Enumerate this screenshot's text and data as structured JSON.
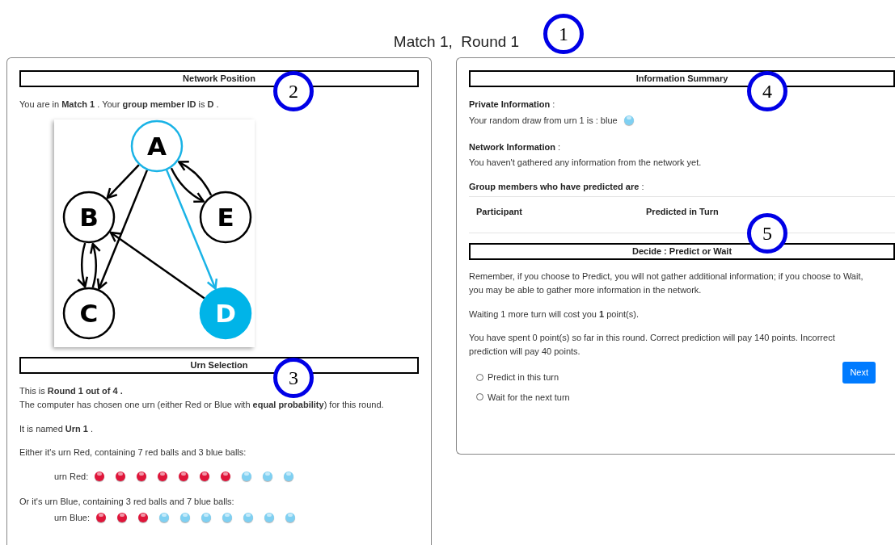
{
  "title": "Match 1,  Round 1",
  "callouts": [
    "1",
    "2",
    "3",
    "4",
    "5"
  ],
  "network": {
    "header": "Network Position",
    "intro": "You are in **Match 1** . Your **group member ID** is **D** .",
    "nodes": [
      {
        "label": "A",
        "kind": "outline"
      },
      {
        "label": "B",
        "kind": "plain"
      },
      {
        "label": "E",
        "kind": "plain"
      },
      {
        "label": "C",
        "kind": "plain"
      },
      {
        "label": "D",
        "kind": "filled"
      }
    ]
  },
  "urn_selection": {
    "header": "Urn Selection",
    "lines": [
      "This is **Round 1 out of 4 .**",
      "The computer has chosen one urn (either Red or Blue with **equal probability**) for this round.",
      "It is named **Urn 1** ."
    ],
    "urns": [
      {
        "intro": "Either it's urn Red, containing 7 red balls and 3 blue balls:",
        "label": "urn Red:",
        "balls": [
          {
            "color": "#e0153a"
          },
          {
            "color": "#e0153a"
          },
          {
            "color": "#e0153a"
          },
          {
            "color": "#e0153a"
          },
          {
            "color": "#e0153a"
          },
          {
            "color": "#e0153a"
          },
          {
            "color": "#e0153a"
          },
          {
            "color": "#7fd0f2"
          },
          {
            "color": "#7fd0f2"
          },
          {
            "color": "#7fd0f2"
          }
        ]
      },
      {
        "intro": "Or it's urn Blue, containing 3 red balls and 7 blue balls:",
        "label": "urn Blue:",
        "balls": [
          {
            "color": "#e0153a"
          },
          {
            "color": "#e0153a"
          },
          {
            "color": "#e0153a"
          },
          {
            "color": "#7fd0f2"
          },
          {
            "color": "#7fd0f2"
          },
          {
            "color": "#7fd0f2"
          },
          {
            "color": "#7fd0f2"
          },
          {
            "color": "#7fd0f2"
          },
          {
            "color": "#7fd0f2"
          },
          {
            "color": "#7fd0f2"
          }
        ]
      }
    ]
  },
  "summary": {
    "header": "Information Summary",
    "private_title": "Private Information",
    "private_sep": ":",
    "private_text": "Your random draw from urn 1 is : blue",
    "private_ball": {
      "color": "#7fd0f2"
    },
    "network_title": "Network Information",
    "network_sep": ":",
    "network_text": "You haven't gathered any information from the network yet.",
    "group_title": "Group members who have predicted are",
    "group_sep": ":",
    "columns": [
      "Participant",
      "Predicted in Turn"
    ]
  },
  "decide": {
    "header": "Decide : Predict or Wait",
    "paragraphs": [
      "Remember, if you choose to Predict, you will not gather additional information; if you choose to Wait, you may be able to gather more information in the network.",
      "Waiting 1 more turn will cost you **1** point(s).",
      "You have spent 0 point(s) so far in this round. Correct prediction will pay 140 points. Incorrect prediction will pay 40 points."
    ],
    "options": [
      {
        "label": "Predict in this turn",
        "selected": false
      },
      {
        "label": "Wait for the next turn",
        "selected": false
      }
    ],
    "button": "Next"
  }
}
